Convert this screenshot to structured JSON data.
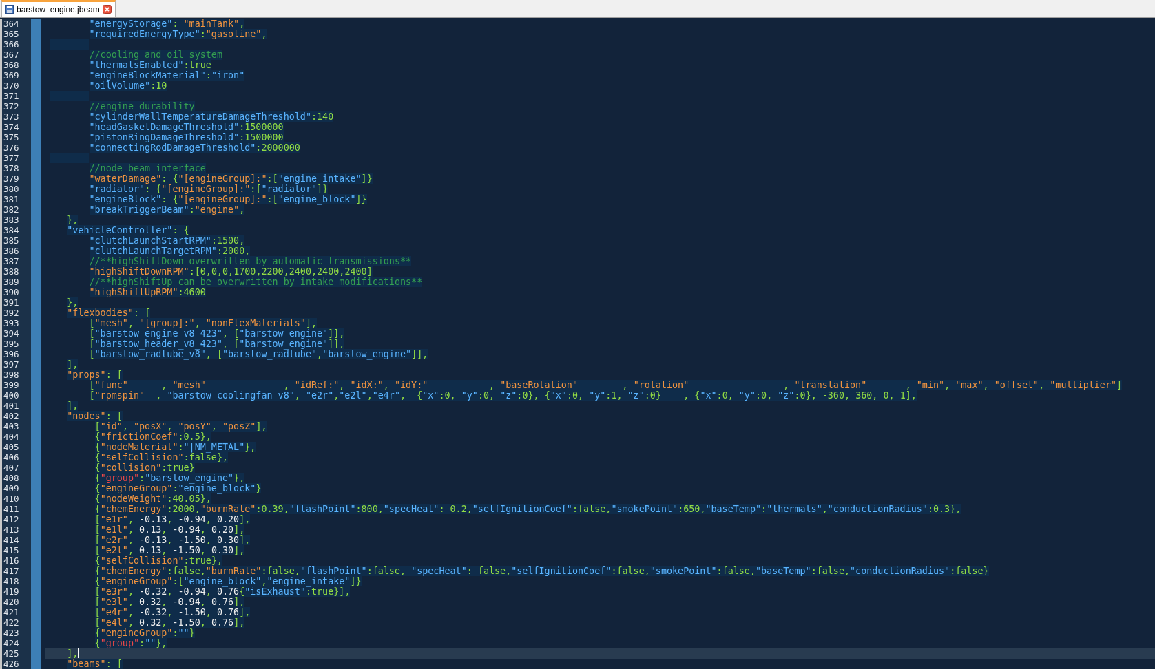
{
  "tabs": [
    {
      "title": "barstow_engine.jbeam",
      "selected": true
    }
  ],
  "editor": {
    "lines": [
      {
        "number": "364",
        "text": "        \"energyStorage\": \"mainTank\",",
        "accent_strings": [
          false,
          true
        ],
        "current": false
      },
      {
        "number": "365",
        "text": "        \"requiredEnergyType\":\"gasoline\",",
        "accent_strings": [
          false,
          true
        ],
        "current": false
      },
      {
        "number": "366",
        "current": false
      },
      {
        "number": "367",
        "text": "        //cooling and oil system",
        "current": false
      },
      {
        "number": "368",
        "text": "        \"thermalsEnabled\":true",
        "current": false
      },
      {
        "number": "369",
        "text": "        \"engineBlockMaterial\":\"iron\"",
        "current": false
      },
      {
        "number": "370",
        "text": "        \"oilVolume\":10",
        "current": false
      },
      {
        "number": "371",
        "current": false
      },
      {
        "number": "372",
        "text": "        //engine durability",
        "current": false
      },
      {
        "number": "373",
        "text": "        \"cylinderWallTemperatureDamageThreshold\":140",
        "current": false
      },
      {
        "number": "374",
        "text": "        \"headGasketDamageThreshold\":1500000",
        "current": false
      },
      {
        "number": "375",
        "text": "        \"pistonRingDamageThreshold\":1500000",
        "current": false
      },
      {
        "number": "376",
        "text": "        \"connectingRodDamageThreshold\":2000000",
        "current": false
      },
      {
        "number": "377",
        "current": false
      },
      {
        "number": "378",
        "text": "        //node beam interface",
        "current": false
      },
      {
        "number": "379",
        "text": "        \"waterDamage\": {\"[engineGroup]:\":[\"engine_intake\"]}",
        "accent_strings": [
          true,
          true,
          false
        ],
        "current": false
      },
      {
        "number": "380",
        "text": "        \"radiator\": {\"[engineGroup]:\":[\"radiator\"]}",
        "accent_strings": [
          false,
          true,
          false
        ],
        "current": false
      },
      {
        "number": "381",
        "text": "        \"engineBlock\": {\"[engineGroup]:\":[\"engine_block\"]}",
        "accent_strings": [
          false,
          true,
          false
        ],
        "current": false
      },
      {
        "number": "382",
        "text": "        \"breakTriggerBeam\":\"engine\",",
        "accent_strings": [
          false,
          true
        ],
        "current": false
      },
      {
        "number": "383",
        "text": "    },",
        "current": false
      },
      {
        "number": "384",
        "text": "    \"vehicleController\": {",
        "current": false
      },
      {
        "number": "385",
        "text": "        \"clutchLaunchStartRPM\":1500,",
        "current": false
      },
      {
        "number": "386",
        "text": "        \"clutchLaunchTargetRPM\":2000,",
        "current": false
      },
      {
        "number": "387",
        "text": "        //**highShiftDown overwritten by automatic transmissions**",
        "current": false
      },
      {
        "number": "388",
        "text": "        \"highShiftDownRPM\":[0,0,0,1700,2200,2400,2400,2400]",
        "accent_strings": [
          true
        ],
        "current": false
      },
      {
        "number": "389",
        "text": "        //**highShiftUp can be overwritten by intake modifications**",
        "current": false
      },
      {
        "number": "390",
        "text": "        \"highShiftUpRPM\":4600",
        "accent_strings": [
          true
        ],
        "current": false
      },
      {
        "number": "391",
        "text": "    },",
        "current": false
      },
      {
        "number": "392",
        "text": "    \"flexbodies\": [",
        "accent_strings": [
          true
        ],
        "current": false
      },
      {
        "number": "393",
        "text": "        [\"mesh\", \"[group]:\", \"nonFlexMaterials\"],",
        "accent_strings": [
          true,
          true,
          true
        ],
        "current": false
      },
      {
        "number": "394",
        "text": "        [\"barstow_engine_v8_423\", [\"barstow_engine\"]],",
        "current": false
      },
      {
        "number": "395",
        "text": "        [\"barstow_header_v8_423\", [\"barstow_engine\"]],",
        "current": false
      },
      {
        "number": "396",
        "text": "        [\"barstow_radtube_v8\", [\"barstow_radtube\",\"barstow_engine\"]],",
        "current": false
      },
      {
        "number": "397",
        "text": "    ],",
        "current": false
      },
      {
        "number": "398",
        "text": "    \"props\": [",
        "accent_strings": [
          true
        ],
        "current": false
      },
      {
        "number": "399",
        "text": "        [\"func\"      , \"mesh\"              , \"idRef:\", \"idX:\", \"idY:\"           , \"baseRotation\"        , \"rotation\"                 , \"translation\"       , \"min\", \"max\", \"offset\", \"multiplier\"]",
        "accent_strings": [
          true,
          true,
          true,
          true,
          true,
          true,
          true,
          true,
          true,
          true,
          true,
          true
        ],
        "current": false
      },
      {
        "number": "400",
        "text": "        [\"rpmspin\"  , \"barstow_coolingfan_v8\", \"e2r\",\"e2l\",\"e4r\",  {\"x\":0, \"y\":0, \"z\":0}, {\"x\":0, \"y\":1, \"z\":0}    , {\"x\":0, \"y\":0, \"z\":0}, -360, 360, 0, 1],",
        "accent_strings": [
          true,
          false
        ],
        "current": false
      },
      {
        "number": "401",
        "text": "    ],",
        "current": false
      },
      {
        "number": "402",
        "text": "    \"nodes\": [",
        "accent_strings": [
          true
        ],
        "current": false
      },
      {
        "number": "403",
        "text": "         [\"id\", \"posX\", \"posY\", \"posZ\"],",
        "accent_strings": [
          true,
          true,
          true,
          true
        ],
        "current": false
      },
      {
        "number": "404",
        "text": "         {\"frictionCoef\":0.5},",
        "accent_strings": [
          true
        ],
        "current": false
      },
      {
        "number": "405",
        "text": "         {\"nodeMaterial\":\"|NM_METAL\"},",
        "accent_strings": [
          true,
          false
        ],
        "current": false
      },
      {
        "number": "406",
        "text": "         {\"selfCollision\":false},",
        "accent_strings": [
          true
        ],
        "current": false
      },
      {
        "number": "407",
        "text": "         {\"collision\":true}",
        "accent_strings": [
          true
        ],
        "current": false
      },
      {
        "number": "408",
        "text": "         {\"group\":\"barstow_engine\"},",
        "accent_strings": [
          true,
          false
        ],
        "alert_keys": true,
        "current": false
      },
      {
        "number": "409",
        "text": "         {\"engineGroup\":\"engine_block\"}",
        "accent_strings": [
          true,
          false
        ],
        "current": false
      },
      {
        "number": "410",
        "text": "         {\"nodeWeight\":40.05},",
        "accent_strings": [
          true
        ],
        "current": false
      },
      {
        "number": "411",
        "text": "         {\"chemEnergy\":2000,\"burnRate\":0.39,\"flashPoint\":800,\"specHeat\": 0.2,\"selfIgnitionCoef\":false,\"smokePoint\":650,\"baseTemp\":\"thermals\",\"conductionRadius\":0.3},",
        "accent_strings": [
          true,
          true,
          false
        ],
        "current": false
      },
      {
        "number": "412",
        "text": "         [\"e1r\", -0.13, -0.94, 0.20],",
        "accent_strings": [
          true
        ],
        "plain_numbers": true,
        "current": false
      },
      {
        "number": "413",
        "text": "         [\"e1l\", 0.13, -0.94, 0.20],",
        "accent_strings": [
          true
        ],
        "plain_numbers": true,
        "current": false
      },
      {
        "number": "414",
        "text": "         [\"e2r\", -0.13, -1.50, 0.30],",
        "accent_strings": [
          true
        ],
        "plain_numbers": true,
        "current": false
      },
      {
        "number": "415",
        "text": "         [\"e2l\", 0.13, -1.50, 0.30],",
        "accent_strings": [
          true
        ],
        "plain_numbers": true,
        "current": false
      },
      {
        "number": "416",
        "text": "         {\"selfCollision\":true},",
        "accent_strings": [
          true
        ],
        "current": false
      },
      {
        "number": "417",
        "text": "         {\"chemEnergy\":false,\"burnRate\":false,\"flashPoint\":false, \"specHeat\": false,\"selfIgnitionCoef\":false,\"smokePoint\":false,\"baseTemp\":false,\"conductionRadius\":false}",
        "accent_strings": [
          true,
          true,
          false
        ],
        "current": false
      },
      {
        "number": "418",
        "text": "         {\"engineGroup\":[\"engine_block\",\"engine_intake\"]}",
        "accent_strings": [
          true,
          false
        ],
        "current": false
      },
      {
        "number": "419",
        "text": "         [\"e3r\", -0.32, -0.94, 0.76{\"isExhaust\":true}],",
        "accent_strings": [
          true,
          false
        ],
        "plain_numbers": true,
        "current": false
      },
      {
        "number": "420",
        "text": "         [\"e3l\", 0.32, -0.94, 0.76],",
        "accent_strings": [
          true
        ],
        "plain_numbers": true,
        "current": false
      },
      {
        "number": "421",
        "text": "         [\"e4r\", -0.32, -1.50, 0.76],",
        "accent_strings": [
          true
        ],
        "plain_numbers": true,
        "current": false
      },
      {
        "number": "422",
        "text": "         [\"e4l\", 0.32, -1.50, 0.76],",
        "accent_strings": [
          true
        ],
        "plain_numbers": true,
        "current": false
      },
      {
        "number": "423",
        "text": "         {\"engineGroup\":\"\"}",
        "accent_strings": [
          true,
          false
        ],
        "current": false
      },
      {
        "number": "424",
        "text": "         {\"group\":\"\"},",
        "accent_strings": [
          true,
          false
        ],
        "alert_keys": true,
        "current": false
      },
      {
        "number": "425",
        "text": "    ],",
        "current": true
      },
      {
        "number": "426",
        "text": "    \"beams\": [",
        "accent_strings": [
          true
        ],
        "current": false
      }
    ]
  }
}
